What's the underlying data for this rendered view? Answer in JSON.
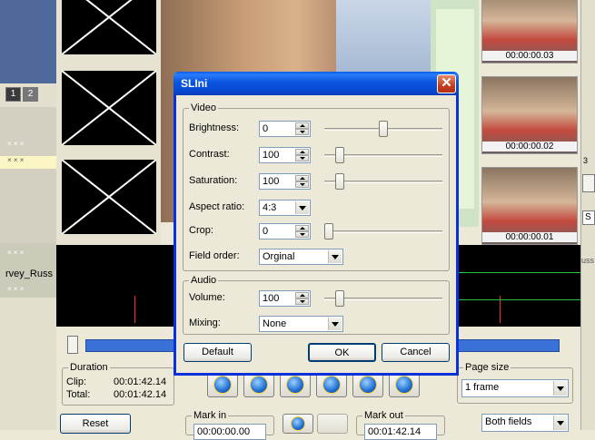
{
  "background": {
    "tabs": [
      "1",
      "2"
    ],
    "left_rows": [
      "× × ×",
      "× × ×",
      "× × ×",
      "× × ×"
    ],
    "left_label": "rvey_Russ",
    "thumb_times": [
      "00:00:00.03",
      "00:00:00.02",
      "00:00:00.01"
    ],
    "right_side": {
      "digit": "3",
      "letter": "S",
      "suffix": "uss"
    },
    "duration": {
      "title": "Duration",
      "clip_label": "Clip:",
      "clip_value": "00:01:42.14",
      "total_label": "Total:",
      "total_value": "00:01:42.14"
    },
    "reset_label": "Reset",
    "mark_in": {
      "label": "Mark in",
      "value": "00:00:00.00"
    },
    "mark_out": {
      "label": "Mark out",
      "value": "00:01:42.14"
    },
    "page_size": {
      "title": "Page size",
      "value": "1 frame"
    },
    "fields_value": "Both fields"
  },
  "dialog": {
    "title": "SLIni",
    "video_group": "Video",
    "audio_group": "Audio",
    "brightness": {
      "label": "Brightness:",
      "value": "0",
      "level": 0.5
    },
    "contrast": {
      "label": "Contrast:",
      "value": "100",
      "level": 0.1
    },
    "saturation": {
      "label": "Saturation:",
      "value": "100",
      "level": 0.1
    },
    "aspect_ratio": {
      "label": "Aspect ratio:",
      "value": "4:3"
    },
    "crop": {
      "label": "Crop:",
      "value": "0",
      "level": 0.0
    },
    "field_order": {
      "label": "Field order:",
      "value": "Orginal"
    },
    "volume": {
      "label": "Volume:",
      "value": "100",
      "level": 0.1
    },
    "mixing": {
      "label": "Mixing:",
      "value": "None"
    },
    "default_label": "Default",
    "ok_label": "OK",
    "cancel_label": "Cancel"
  },
  "colors": {
    "title_blue": "#0a54de",
    "close_red": "#c43e1e",
    "timeline_blue": "#3a71d6",
    "scope_red": "#ff2a2a",
    "scope_green": "#23c04a"
  }
}
